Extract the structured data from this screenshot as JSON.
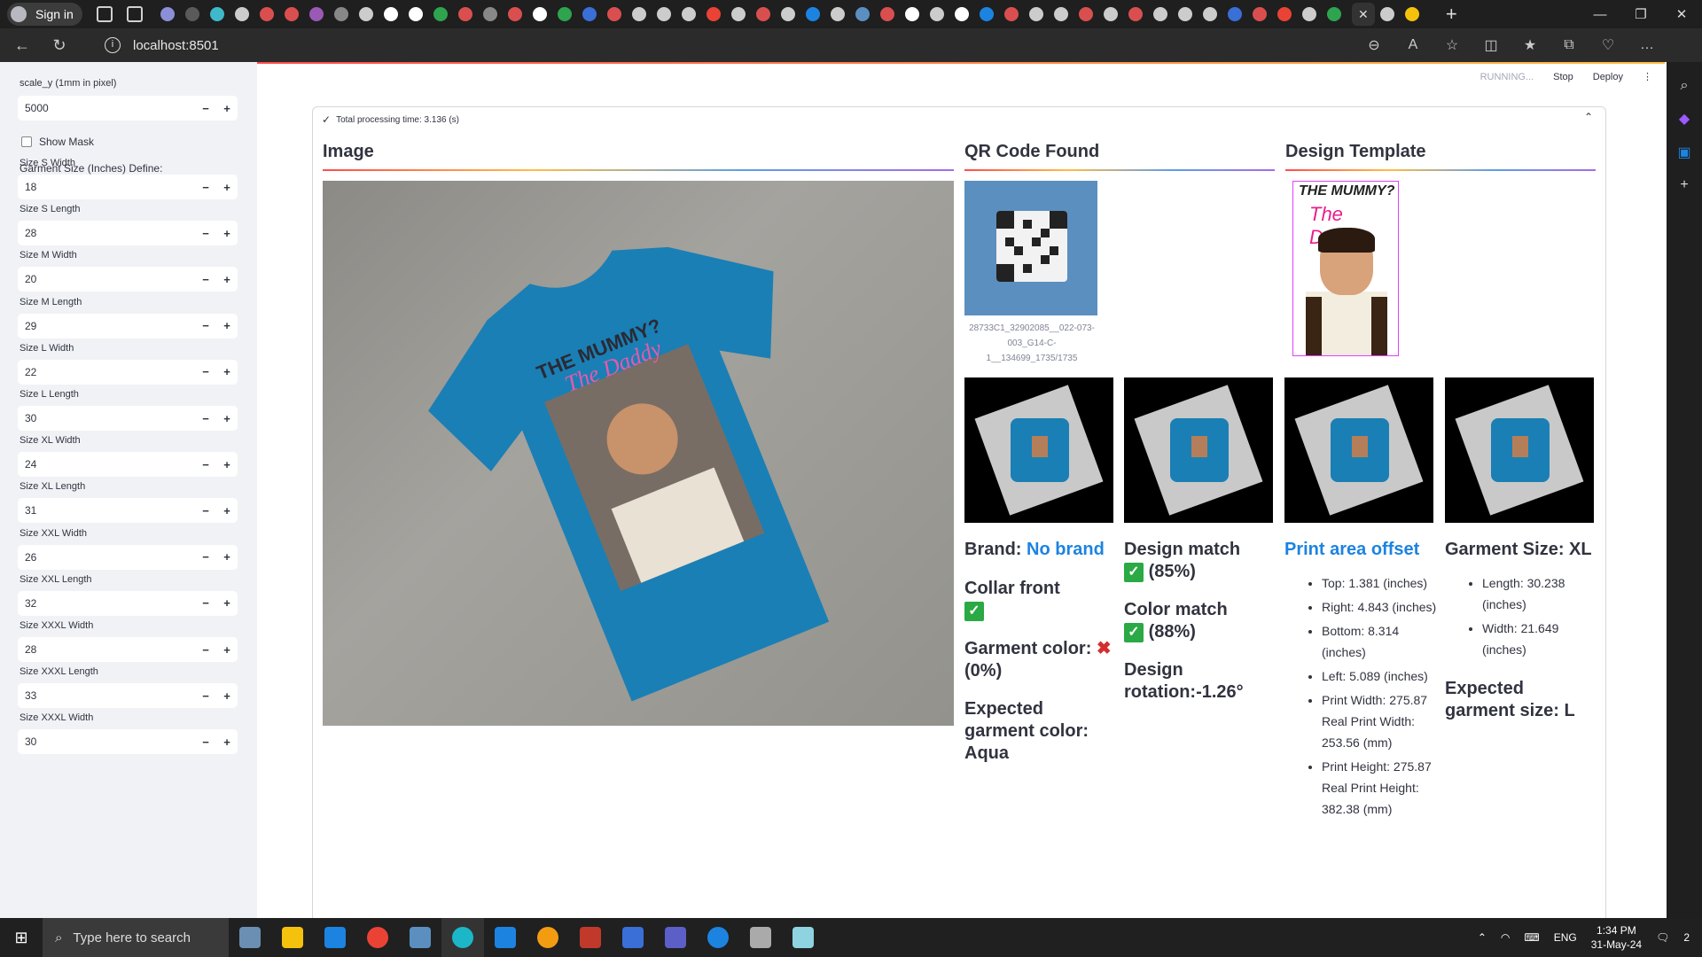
{
  "browser": {
    "signin_label": "Sign in",
    "url": "localhost:8501"
  },
  "header": {
    "running": "RUNNING...",
    "stop": "Stop",
    "deploy": "Deploy"
  },
  "sidebar": {
    "scale_label": "scale_y (1mm in pixel)",
    "scale_value": "5000",
    "show_mask": "Show Mask",
    "garment_define": "Garment Size (Inches) Define:",
    "fields": [
      {
        "label": "Size S Width",
        "value": "18"
      },
      {
        "label": "Size S Length",
        "value": "28"
      },
      {
        "label": "Size M Width",
        "value": "20"
      },
      {
        "label": "Size M Length",
        "value": "29"
      },
      {
        "label": "Size L Width",
        "value": "22"
      },
      {
        "label": "Size L Length",
        "value": "30"
      },
      {
        "label": "Size XL Width",
        "value": "24"
      },
      {
        "label": "Size XL Length",
        "value": "31"
      },
      {
        "label": "Size XXL Width",
        "value": "26"
      },
      {
        "label": "Size XXL Length",
        "value": "32"
      },
      {
        "label": "Size XXXL Width",
        "value": "28"
      },
      {
        "label": "Size XXXL Length",
        "value": "33"
      },
      {
        "label": "Size XXXL Width",
        "value": "30"
      }
    ]
  },
  "expander": {
    "title": "Total processing time: 3.136 (s)"
  },
  "sections": {
    "image": "Image",
    "qr": "QR Code Found",
    "design": "Design Template"
  },
  "design_image": {
    "line1": "THE MUMMY?",
    "line2": "The Daddy"
  },
  "shirt_print": {
    "line1": "THE MUMMY?",
    "line2": "The Daddy"
  },
  "qr_caption": "28733C1_32902085__022-073-003_G14-C-1__134699_1735/1735",
  "results": {
    "brand_label": "Brand:",
    "brand_value": "No brand",
    "collar": "Collar front",
    "garment_color": "Garment color:",
    "garment_color_pct": "(0%)",
    "expected_color": "Expected garment color: Aqua",
    "design_match": "Design match",
    "design_match_pct": "(85%)",
    "color_match": "Color match",
    "color_match_pct": "(88%)",
    "rotation": "Design rotation:-1.26°",
    "print_offset_title": "Print area offset",
    "offsets": [
      "Top: 1.381 (inches)",
      "Right: 4.843 (inches)",
      "Bottom: 8.314 (inches)",
      "Left: 5.089 (inches)",
      "Print Width: 275.87 Real Print Width: 253.56 (mm)",
      "Print Height: 275.87 Real Print Height: 382.38 (mm)"
    ],
    "garment_size_title": "Garment Size: XL",
    "sizes": [
      "Length: 30.238 (inches)",
      "Width: 21.649 (inches)"
    ],
    "expected_size": "Expected garment size: L"
  },
  "taskbar": {
    "search_placeholder": "Type here to search",
    "lang": "ENG",
    "time": "1:34 PM",
    "date": "31-May-24",
    "notifications": "2"
  }
}
